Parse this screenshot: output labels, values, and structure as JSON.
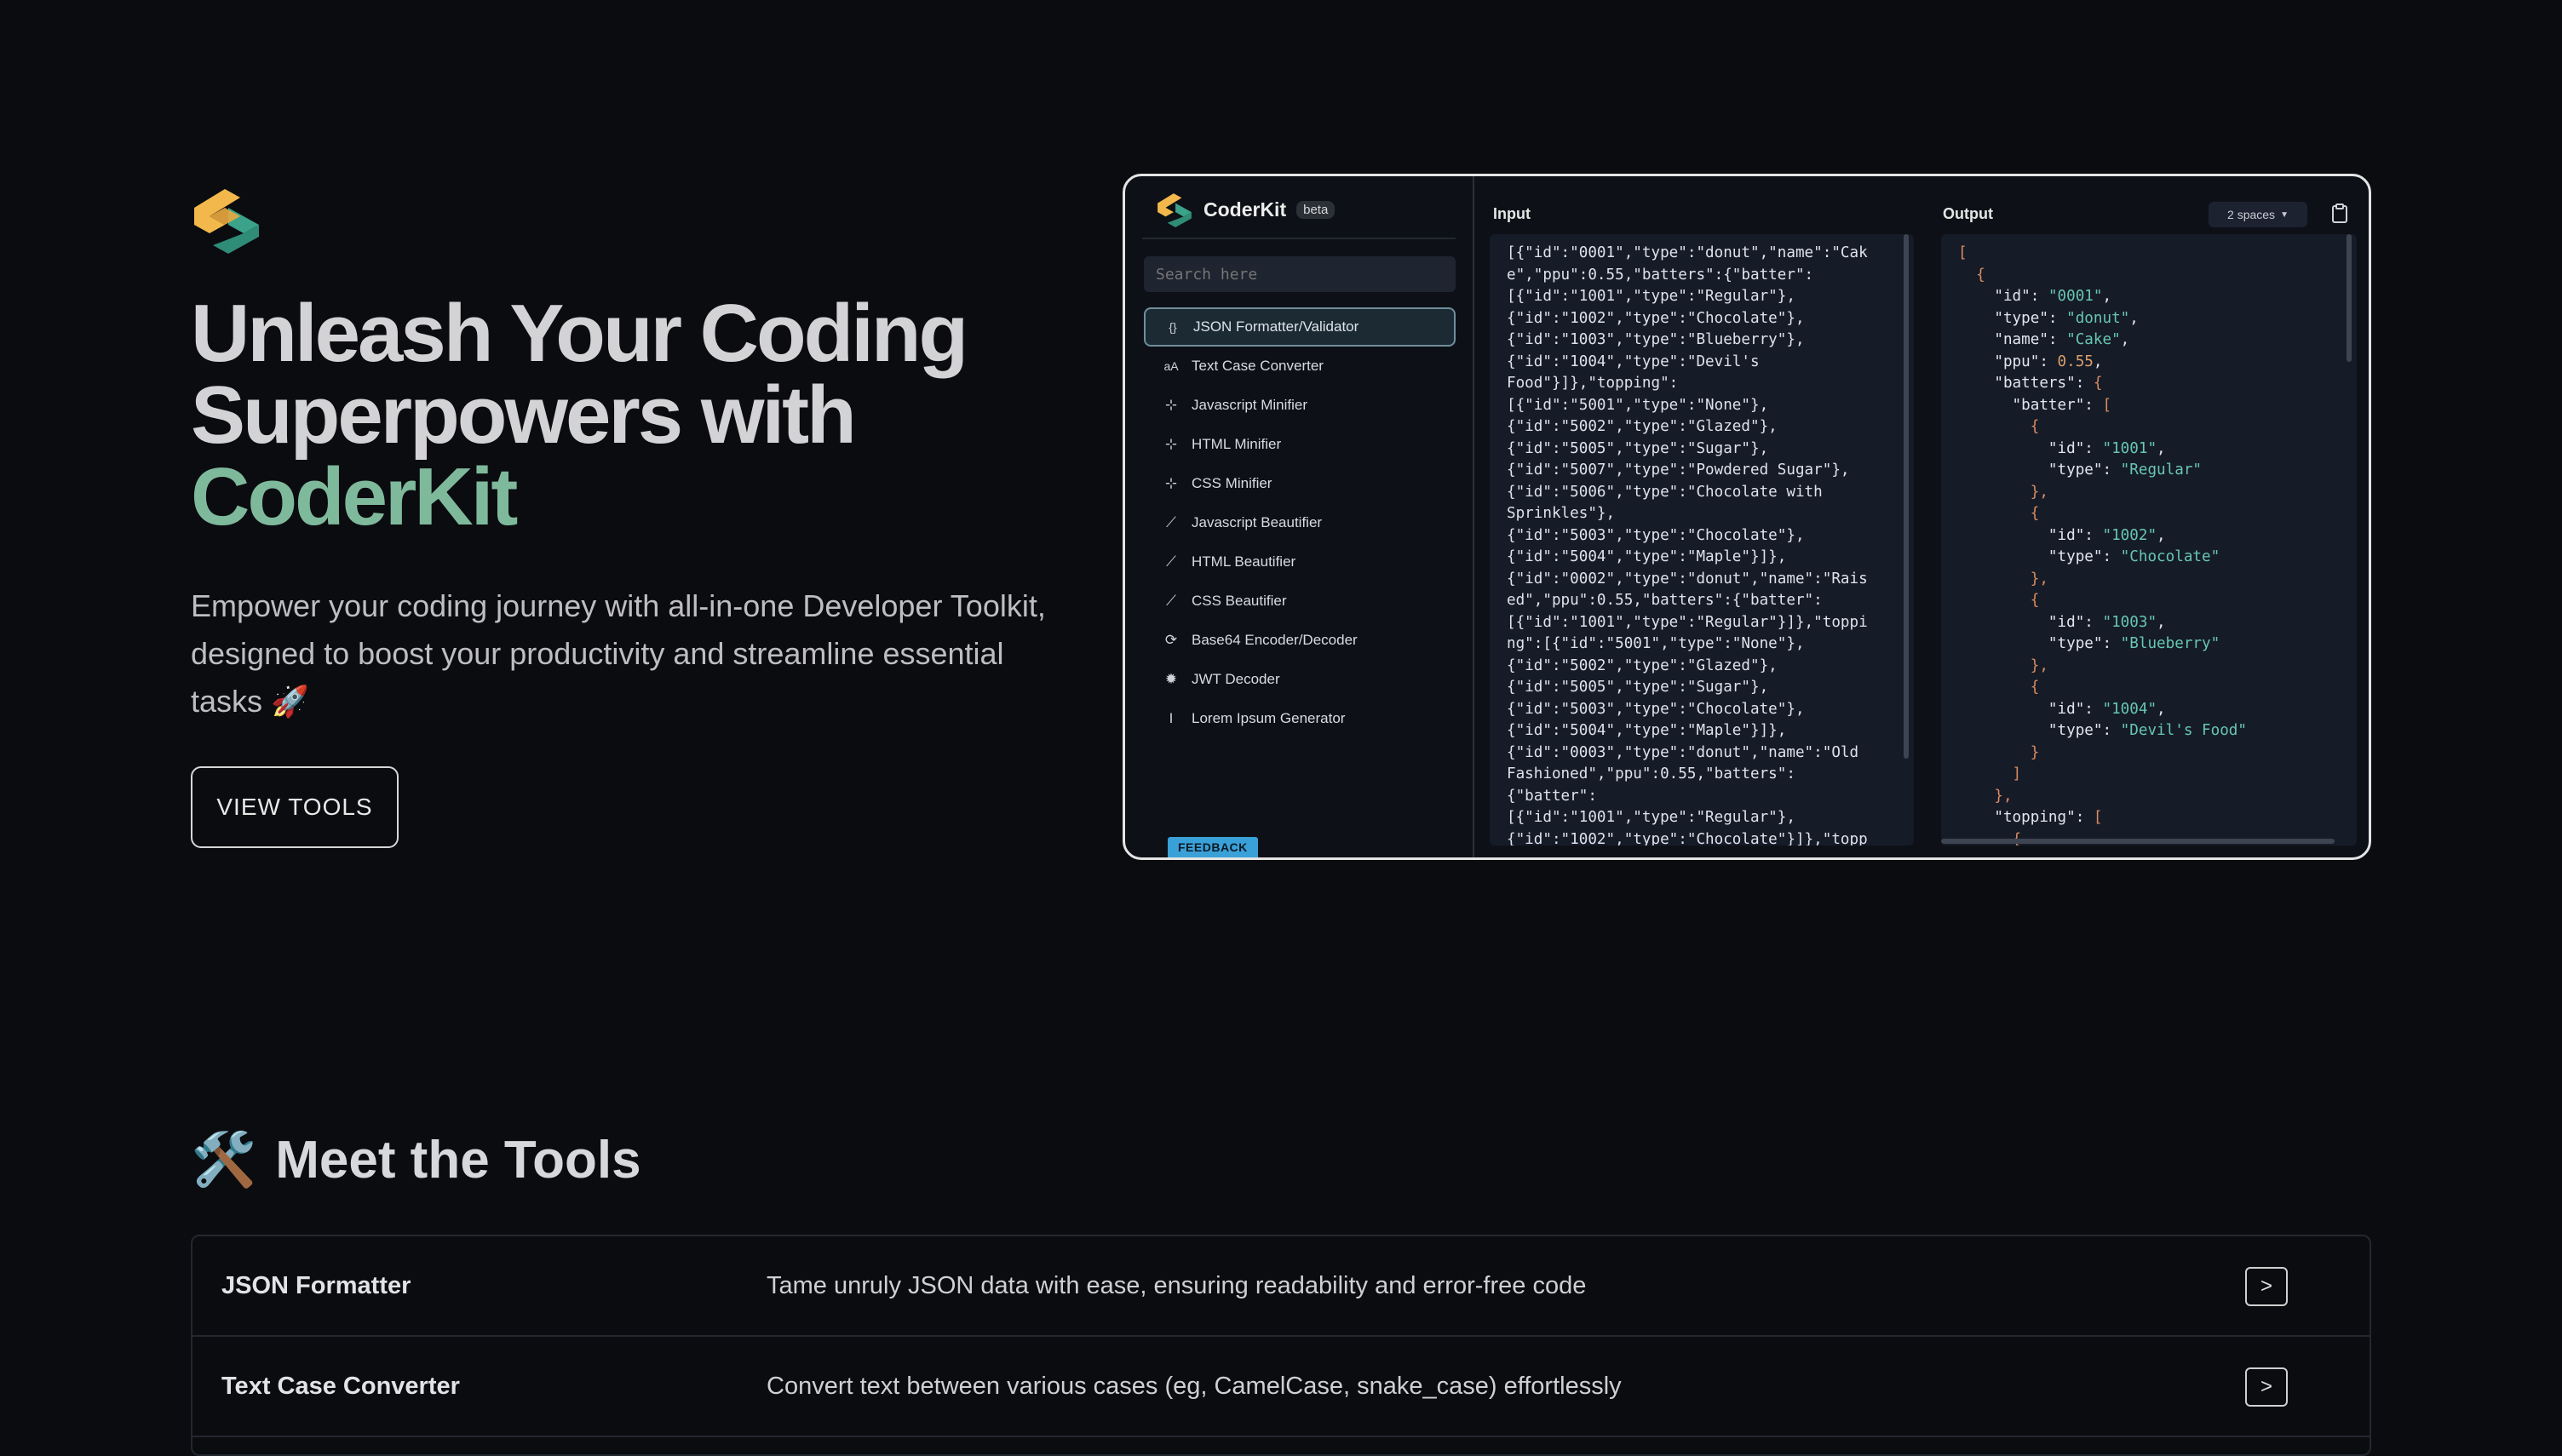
{
  "hero": {
    "title_line1": "Unleash Your Coding",
    "title_line2": "Superpowers with",
    "title_accent": "CoderKit",
    "subtitle": "Empower your coding journey with all-in-one Developer Toolkit, designed to boost your productivity and streamline essential tasks 🚀",
    "cta_label": "VIEW TOOLS"
  },
  "app": {
    "brand": "CoderKit",
    "badge": "beta",
    "search_placeholder": "Search here",
    "tools": [
      {
        "label": "JSON Formatter/Validator",
        "icon": "braces-icon"
      },
      {
        "label": "Text Case Converter",
        "icon": "text-case-icon"
      },
      {
        "label": "Javascript Minifier",
        "icon": "minify-icon"
      },
      {
        "label": "HTML Minifier",
        "icon": "minify-icon"
      },
      {
        "label": "CSS Minifier",
        "icon": "minify-icon"
      },
      {
        "label": "Javascript Beautifier",
        "icon": "magic-wand-icon"
      },
      {
        "label": "HTML Beautifier",
        "icon": "magic-wand-icon"
      },
      {
        "label": "CSS Beautifier",
        "icon": "magic-wand-icon"
      },
      {
        "label": "Base64 Encoder/Decoder",
        "icon": "sync-icon"
      },
      {
        "label": "JWT Decoder",
        "icon": "gear-icon"
      },
      {
        "label": "Lorem Ipsum Generator",
        "icon": "text-cursor-icon"
      }
    ],
    "feedback_label": "FEEDBACK",
    "input_label": "Input",
    "output_label": "Output",
    "indent_option": "2 spaces",
    "input_text": "[{\"id\":\"0001\",\"type\":\"donut\",\"name\":\"Cak\ne\",\"ppu\":0.55,\"batters\":{\"batter\":\n[{\"id\":\"1001\",\"type\":\"Regular\"},\n{\"id\":\"1002\",\"type\":\"Chocolate\"},\n{\"id\":\"1003\",\"type\":\"Blueberry\"},\n{\"id\":\"1004\",\"type\":\"Devil's\nFood\"}]},\"topping\":\n[{\"id\":\"5001\",\"type\":\"None\"},\n{\"id\":\"5002\",\"type\":\"Glazed\"},\n{\"id\":\"5005\",\"type\":\"Sugar\"},\n{\"id\":\"5007\",\"type\":\"Powdered Sugar\"},\n{\"id\":\"5006\",\"type\":\"Chocolate with\nSprinkles\"},\n{\"id\":\"5003\",\"type\":\"Chocolate\"},\n{\"id\":\"5004\",\"type\":\"Maple\"}]},\n{\"id\":\"0002\",\"type\":\"donut\",\"name\":\"Rais\ned\",\"ppu\":0.55,\"batters\":{\"batter\":\n[{\"id\":\"1001\",\"type\":\"Regular\"}]},\"toppi\nng\":[{\"id\":\"5001\",\"type\":\"None\"},\n{\"id\":\"5002\",\"type\":\"Glazed\"},\n{\"id\":\"5005\",\"type\":\"Sugar\"},\n{\"id\":\"5003\",\"type\":\"Chocolate\"},\n{\"id\":\"5004\",\"type\":\"Maple\"}]},\n{\"id\":\"0003\",\"type\":\"donut\",\"name\":\"Old\nFashioned\",\"ppu\":0.55,\"batters\":\n{\"batter\":\n[{\"id\":\"1001\",\"type\":\"Regular\"},\n{\"id\":\"1002\",\"type\":\"Chocolate\"}]},\"topp",
    "output_lines": [
      [
        [
          "[",
          "br"
        ]
      ],
      [
        [
          "  {",
          "br"
        ]
      ],
      [
        [
          "    \"id\": ",
          "key"
        ],
        [
          "\"0001\"",
          "str"
        ],
        [
          ",",
          "key"
        ]
      ],
      [
        [
          "    \"type\": ",
          "key"
        ],
        [
          "\"donut\"",
          "str"
        ],
        [
          ",",
          "key"
        ]
      ],
      [
        [
          "    \"name\": ",
          "key"
        ],
        [
          "\"Cake\"",
          "str"
        ],
        [
          ",",
          "key"
        ]
      ],
      [
        [
          "    \"ppu\": ",
          "key"
        ],
        [
          "0.55",
          "num"
        ],
        [
          ",",
          "key"
        ]
      ],
      [
        [
          "    \"batters\": ",
          "key"
        ],
        [
          "{",
          "br"
        ]
      ],
      [
        [
          "      \"batter\": ",
          "key"
        ],
        [
          "[",
          "br"
        ]
      ],
      [
        [
          "        {",
          "br"
        ]
      ],
      [
        [
          "          \"id\": ",
          "key"
        ],
        [
          "\"1001\"",
          "str"
        ],
        [
          ",",
          "key"
        ]
      ],
      [
        [
          "          \"type\": ",
          "key"
        ],
        [
          "\"Regular\"",
          "str"
        ]
      ],
      [
        [
          "        },",
          "br"
        ]
      ],
      [
        [
          "        {",
          "br"
        ]
      ],
      [
        [
          "          \"id\": ",
          "key"
        ],
        [
          "\"1002\"",
          "str"
        ],
        [
          ",",
          "key"
        ]
      ],
      [
        [
          "          \"type\": ",
          "key"
        ],
        [
          "\"Chocolate\"",
          "str"
        ]
      ],
      [
        [
          "        },",
          "br"
        ]
      ],
      [
        [
          "        {",
          "br"
        ]
      ],
      [
        [
          "          \"id\": ",
          "key"
        ],
        [
          "\"1003\"",
          "str"
        ],
        [
          ",",
          "key"
        ]
      ],
      [
        [
          "          \"type\": ",
          "key"
        ],
        [
          "\"Blueberry\"",
          "str"
        ]
      ],
      [
        [
          "        },",
          "br"
        ]
      ],
      [
        [
          "        {",
          "br"
        ]
      ],
      [
        [
          "          \"id\": ",
          "key"
        ],
        [
          "\"1004\"",
          "str"
        ],
        [
          ",",
          "key"
        ]
      ],
      [
        [
          "          \"type\": ",
          "key"
        ],
        [
          "\"Devil's Food\"",
          "str"
        ]
      ],
      [
        [
          "        }",
          "br"
        ]
      ],
      [
        [
          "      ]",
          "br"
        ]
      ],
      [
        [
          "    },",
          "br"
        ]
      ],
      [
        [
          "    \"topping\": ",
          "key"
        ],
        [
          "[",
          "br"
        ]
      ],
      [
        [
          "      {",
          "br"
        ]
      ]
    ]
  },
  "tools_section": {
    "emoji": "🛠️",
    "title": "Meet the Tools",
    "rows": [
      {
        "name": "JSON Formatter",
        "desc": "Tame unruly JSON data with ease, ensuring readability and error-free code",
        "button": ">"
      },
      {
        "name": "Text Case Converter",
        "desc": "Convert text between various cases (eg, CamelCase, snake_case) effortlessly",
        "button": ">"
      }
    ]
  },
  "colors": {
    "background": "#0b0c10",
    "accent_green": "#7fb99c",
    "logo_yellow": "#f2b84b",
    "logo_teal": "#3aa38a",
    "feedback_blue": "#3aa0d8"
  }
}
